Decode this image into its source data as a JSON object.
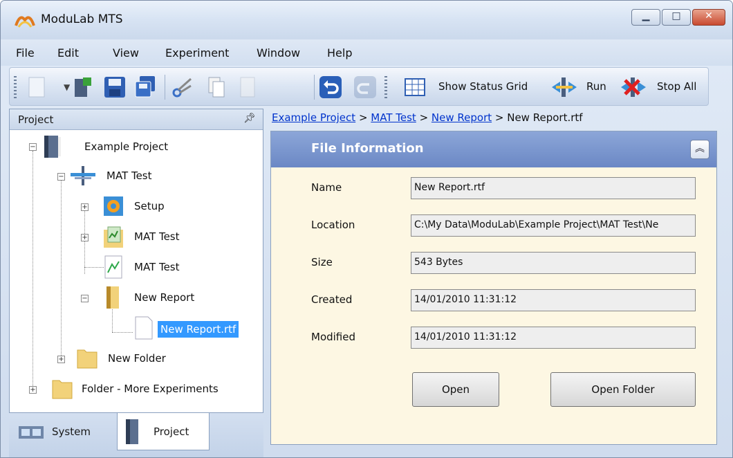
{
  "window": {
    "title": "ModuLab MTS"
  },
  "menu": [
    {
      "label": "File"
    },
    {
      "label": "Edit"
    },
    {
      "label": "View"
    },
    {
      "label": "Experiment"
    },
    {
      "label": "Window"
    },
    {
      "label": "Help"
    }
  ],
  "toolbar": {
    "show_status_grid": "Show Status Grid",
    "run": "Run",
    "stop_all": "Stop All"
  },
  "project_panel": {
    "title": "Project",
    "tree": [
      {
        "label": "Example Project",
        "level": 0,
        "icon": "project-book-icon"
      },
      {
        "label": "MAT Test",
        "level": 1,
        "icon": "test-plug-icon"
      },
      {
        "label": "Setup",
        "level": 2,
        "icon": "setup-gear-icon"
      },
      {
        "label": "MAT Test",
        "level": 2,
        "icon": "data-folder-icon"
      },
      {
        "label": "MAT Test",
        "level": 2,
        "icon": "graph-document-icon"
      },
      {
        "label": "New Report",
        "level": 2,
        "icon": "report-book-icon"
      },
      {
        "label": "New Report.rtf",
        "level": 3,
        "icon": "rtf-document-icon",
        "selected": true
      },
      {
        "label": "New Folder",
        "level": 1,
        "icon": "folder-icon"
      },
      {
        "label": "Folder - More Experiments",
        "level": 0,
        "icon": "folder-icon"
      }
    ]
  },
  "bottom_tabs": [
    {
      "label": "System",
      "active": false
    },
    {
      "label": "Project",
      "active": true
    }
  ],
  "breadcrumb": {
    "items": [
      "Example Project",
      "MAT Test",
      "New Report"
    ],
    "separator": " > ",
    "current": "New Report.rtf"
  },
  "file_info": {
    "title": "File Information",
    "fields": [
      {
        "label": "Name",
        "value": "New Report.rtf"
      },
      {
        "label": "Location",
        "value": "C:\\My Data\\ModuLab\\Example Project\\MAT Test\\Ne"
      },
      {
        "label": "Size",
        "value": "543 Bytes"
      },
      {
        "label": "Created",
        "value": "14/01/2010 11:31:12"
      },
      {
        "label": "Modified",
        "value": "14/01/2010 11:31:12"
      }
    ],
    "open_button": "Open",
    "open_folder_button": "Open Folder"
  },
  "colors": {
    "section_header": "#7a95cf",
    "content_bg": "#fdf7e3",
    "selection": "#3399ff",
    "link": "#0033cc"
  }
}
